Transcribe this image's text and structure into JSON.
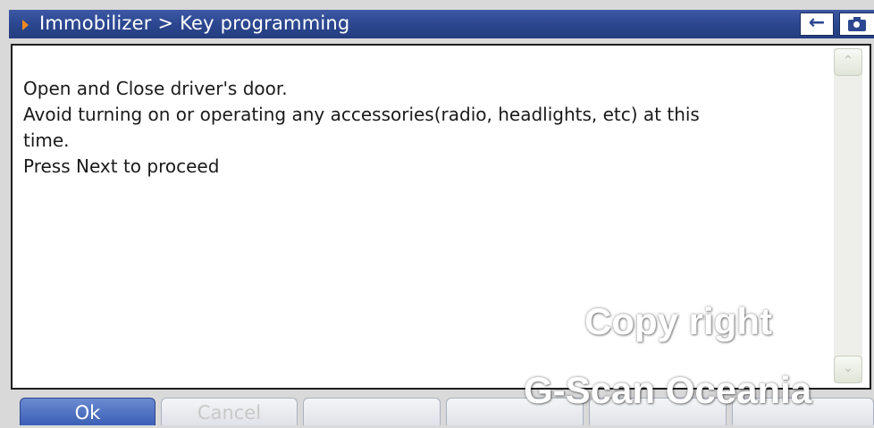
{
  "header": {
    "title": "Immobilizer > Key programming",
    "back_icon": "←"
  },
  "message": {
    "lines": [
      "Open and Close driver's door.",
      "Avoid turning on or operating any accessories(radio, headlights, etc) at this",
      "time.",
      "Press Next to proceed"
    ]
  },
  "scrollbar": {
    "up_icon": "⌃",
    "down_icon": "⌄"
  },
  "buttons": [
    {
      "label": "Ok"
    },
    {
      "label": "Cancel"
    },
    {
      "label": ""
    },
    {
      "label": ""
    },
    {
      "label": ""
    },
    {
      "label": ""
    }
  ],
  "watermark": {
    "line1": "Copy right",
    "line2": "G-Scan Oceania"
  },
  "colors": {
    "titlebar": "#2c4790",
    "accent_arrow": "#f08a1c",
    "primary_button": "#4a6cc0"
  }
}
